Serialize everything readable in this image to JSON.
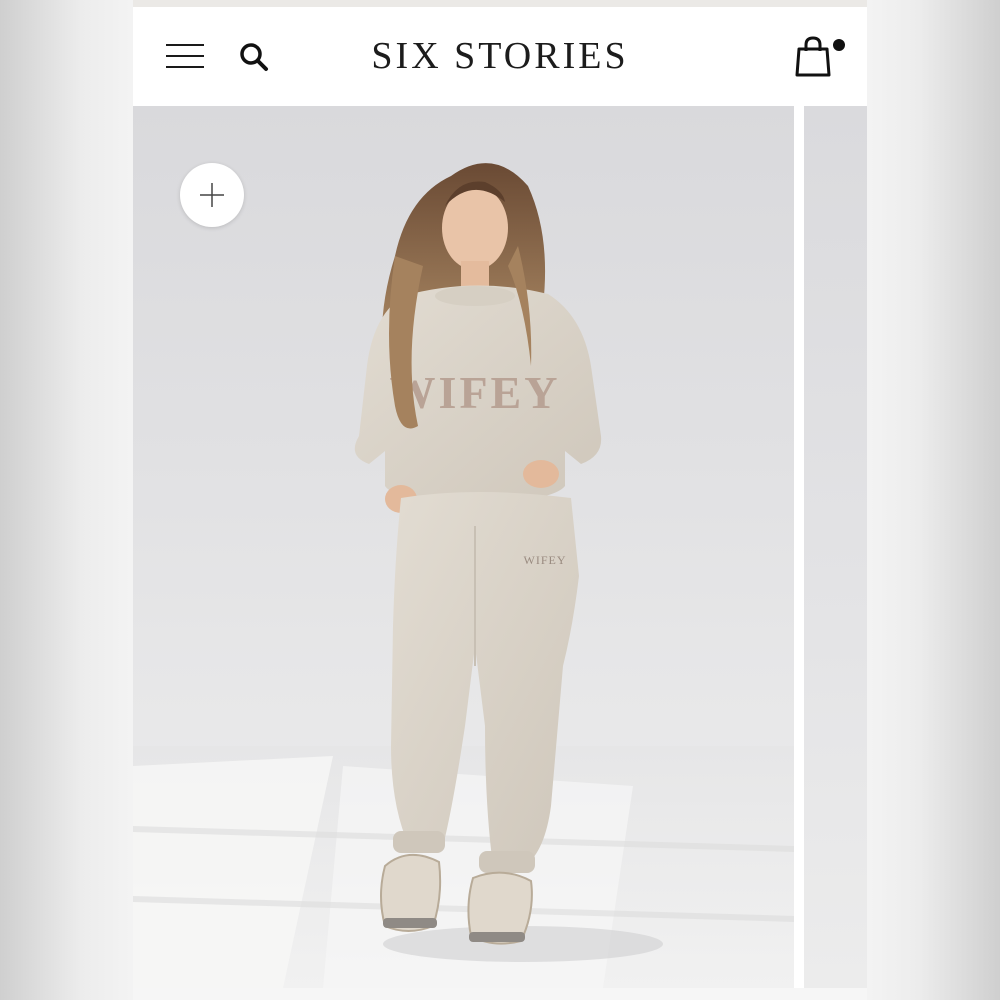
{
  "header": {
    "brand": "SIX STORIES",
    "menu_icon": "hamburger-menu-icon",
    "search_icon": "search-icon",
    "cart_icon": "shopping-bag-icon",
    "cart_has_items": true
  },
  "gallery": {
    "add_button_icon": "plus-icon",
    "product_print": "WIFEY",
    "pants_print": "WIFEY"
  },
  "colors": {
    "header_bg": "#ffffff",
    "text": "#1c1c1c",
    "garment": "#ddd6cb",
    "print": "#b9a396",
    "backdrop": "#e1e1e3"
  }
}
